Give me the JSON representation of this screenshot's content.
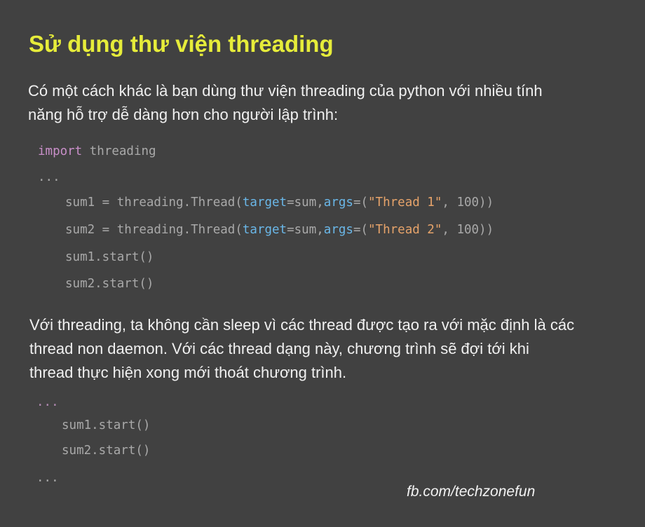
{
  "title": "Sử dụng thư viện threading",
  "intro": {
    "line1": "Có một cách khác là bạn dùng thư viện threading của python với nhiều tính",
    "line2": "năng hỗ trợ dễ dàng hơn cho người lập trình:"
  },
  "code1": {
    "import_kw": "import",
    "import_mod": " threading",
    "dots": "...",
    "line_sum1": {
      "pre": "sum1 = threading.Thread(",
      "target_kw": "target",
      "eq1": "=sum,",
      "args_kw": "args",
      "eq2": "=(",
      "str": "\"Thread 1\"",
      "post": ", 100))"
    },
    "line_sum2": {
      "pre": "sum2 = threading.Thread(",
      "target_kw": "target",
      "eq1": "=sum,",
      "args_kw": "args",
      "eq2": "=(",
      "str": "\"Thread 2\"",
      "post": ", 100))"
    },
    "start1": "sum1.start()",
    "start2": "sum2.start()"
  },
  "explanation": {
    "line1": "Với threading, ta không cần sleep vì các thread được tạo ra với mặc định là các",
    "line2": "thread non daemon. Với các thread dạng này, chương trình sẽ đợi tới khi",
    "line3": "thread thực hiện xong mới thoát chương trình."
  },
  "code2": {
    "dots_top": "...",
    "start1": "sum1.start()",
    "start2": "sum2.start()",
    "dots_bottom": "..."
  },
  "credit": "fb.com/techzonefun",
  "colors": {
    "background": "#414141",
    "title": "#e6ec3a",
    "keyword": "#c98fc9",
    "attribute": "#6ab7e8",
    "string": "#e6a36a"
  }
}
